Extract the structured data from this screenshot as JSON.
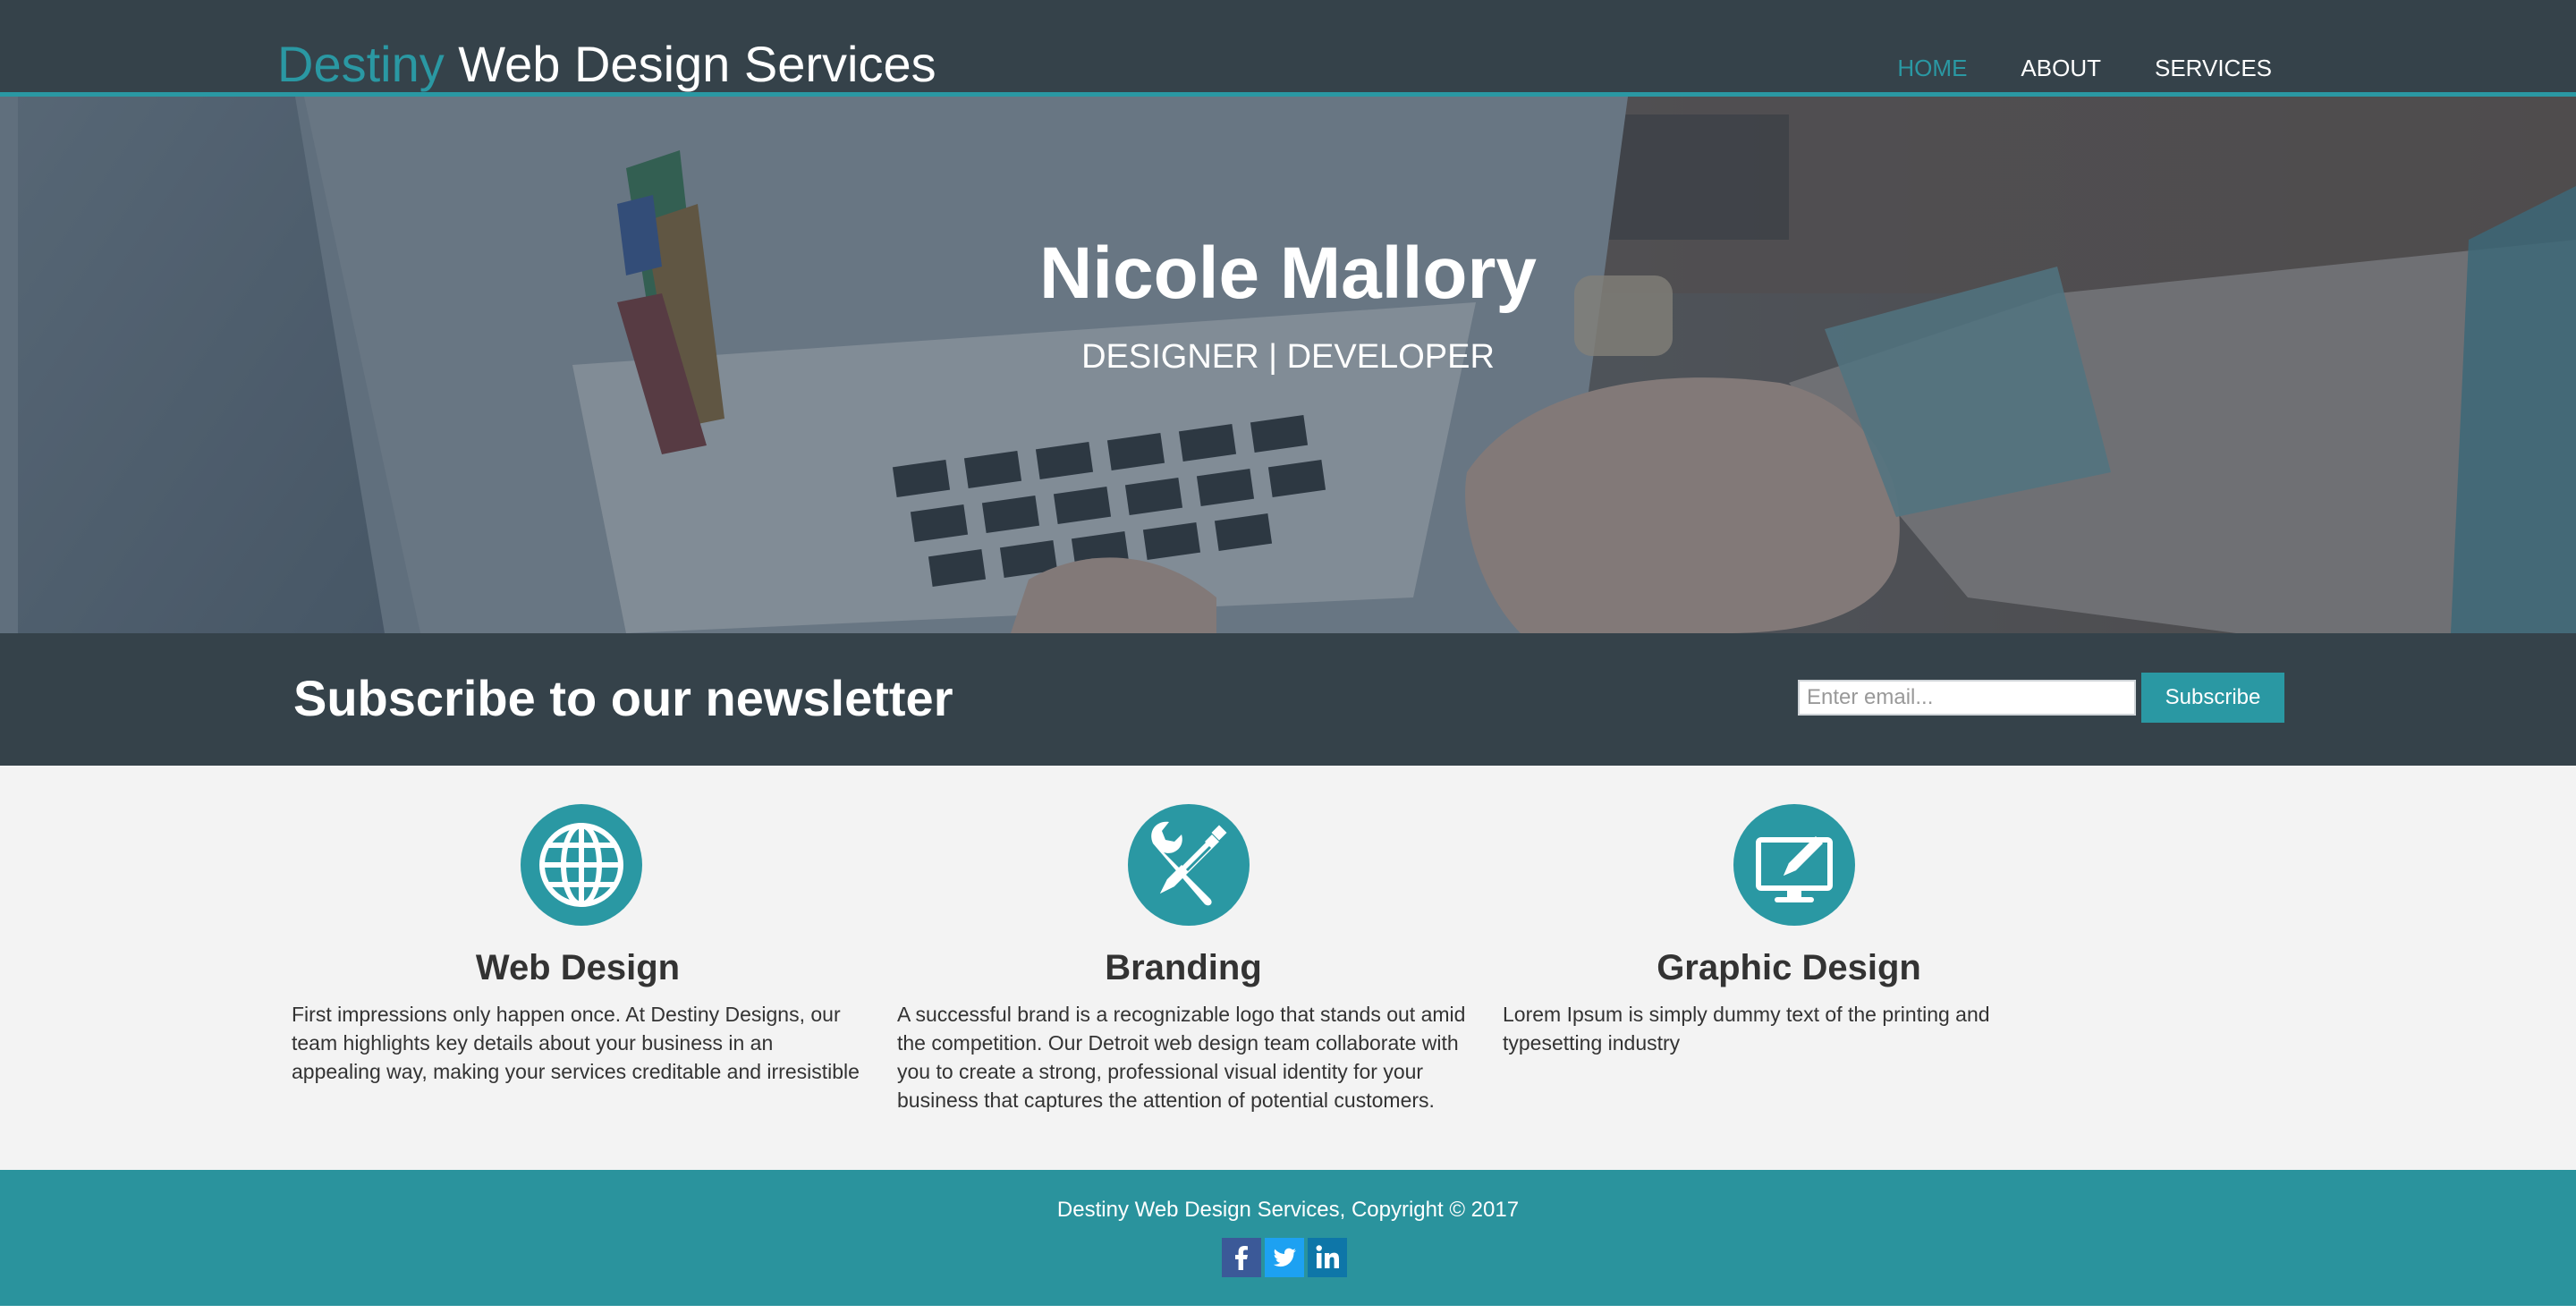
{
  "header": {
    "logo_highlight": "Destiny",
    "logo_rest": " Web Design Services",
    "nav": [
      {
        "label": "HOME",
        "current": true
      },
      {
        "label": "ABOUT",
        "current": false
      },
      {
        "label": "SERVICES",
        "current": false
      }
    ]
  },
  "hero": {
    "title": "Nicole Mallory",
    "subtitle": "DESIGNER | DEVELOPER"
  },
  "newsletter": {
    "heading": "Subscribe to our newsletter",
    "email_placeholder": "Enter email...",
    "email_value": "",
    "button_label": "Subscribe"
  },
  "boxes": [
    {
      "icon": "globe-icon",
      "title": "Web Design",
      "text": "First impressions only happen once. At Destiny Designs, our team highlights key details about your business in an appealing way, making your services creditable and irresistible"
    },
    {
      "icon": "wrench-pencil-icon",
      "title": "Branding",
      "text": "A successful brand is a recognizable logo that stands out amid the competition. Our Detroit web design team collaborate with you to create a strong, professional visual identity for your business that captures the attention of potential customers."
    },
    {
      "icon": "monitor-pen-icon",
      "title": "Graphic Design",
      "text": "Lorem Ipsum is simply dummy text of the printing and typesetting industry"
    }
  ],
  "footer": {
    "copyright": "Destiny Web Design Services, Copyright © 2017",
    "social": [
      {
        "icon": "facebook-icon",
        "glyph": "f",
        "color": "#3b5998"
      },
      {
        "icon": "twitter-icon",
        "glyph": "t",
        "color": "#1da1f2"
      },
      {
        "icon": "linkedin-icon",
        "glyph": "in",
        "color": "#0e76a8"
      }
    ]
  },
  "colors": {
    "accent": "#2a98a3",
    "dark": "#35424a",
    "light_bg": "#f3f3f3"
  }
}
